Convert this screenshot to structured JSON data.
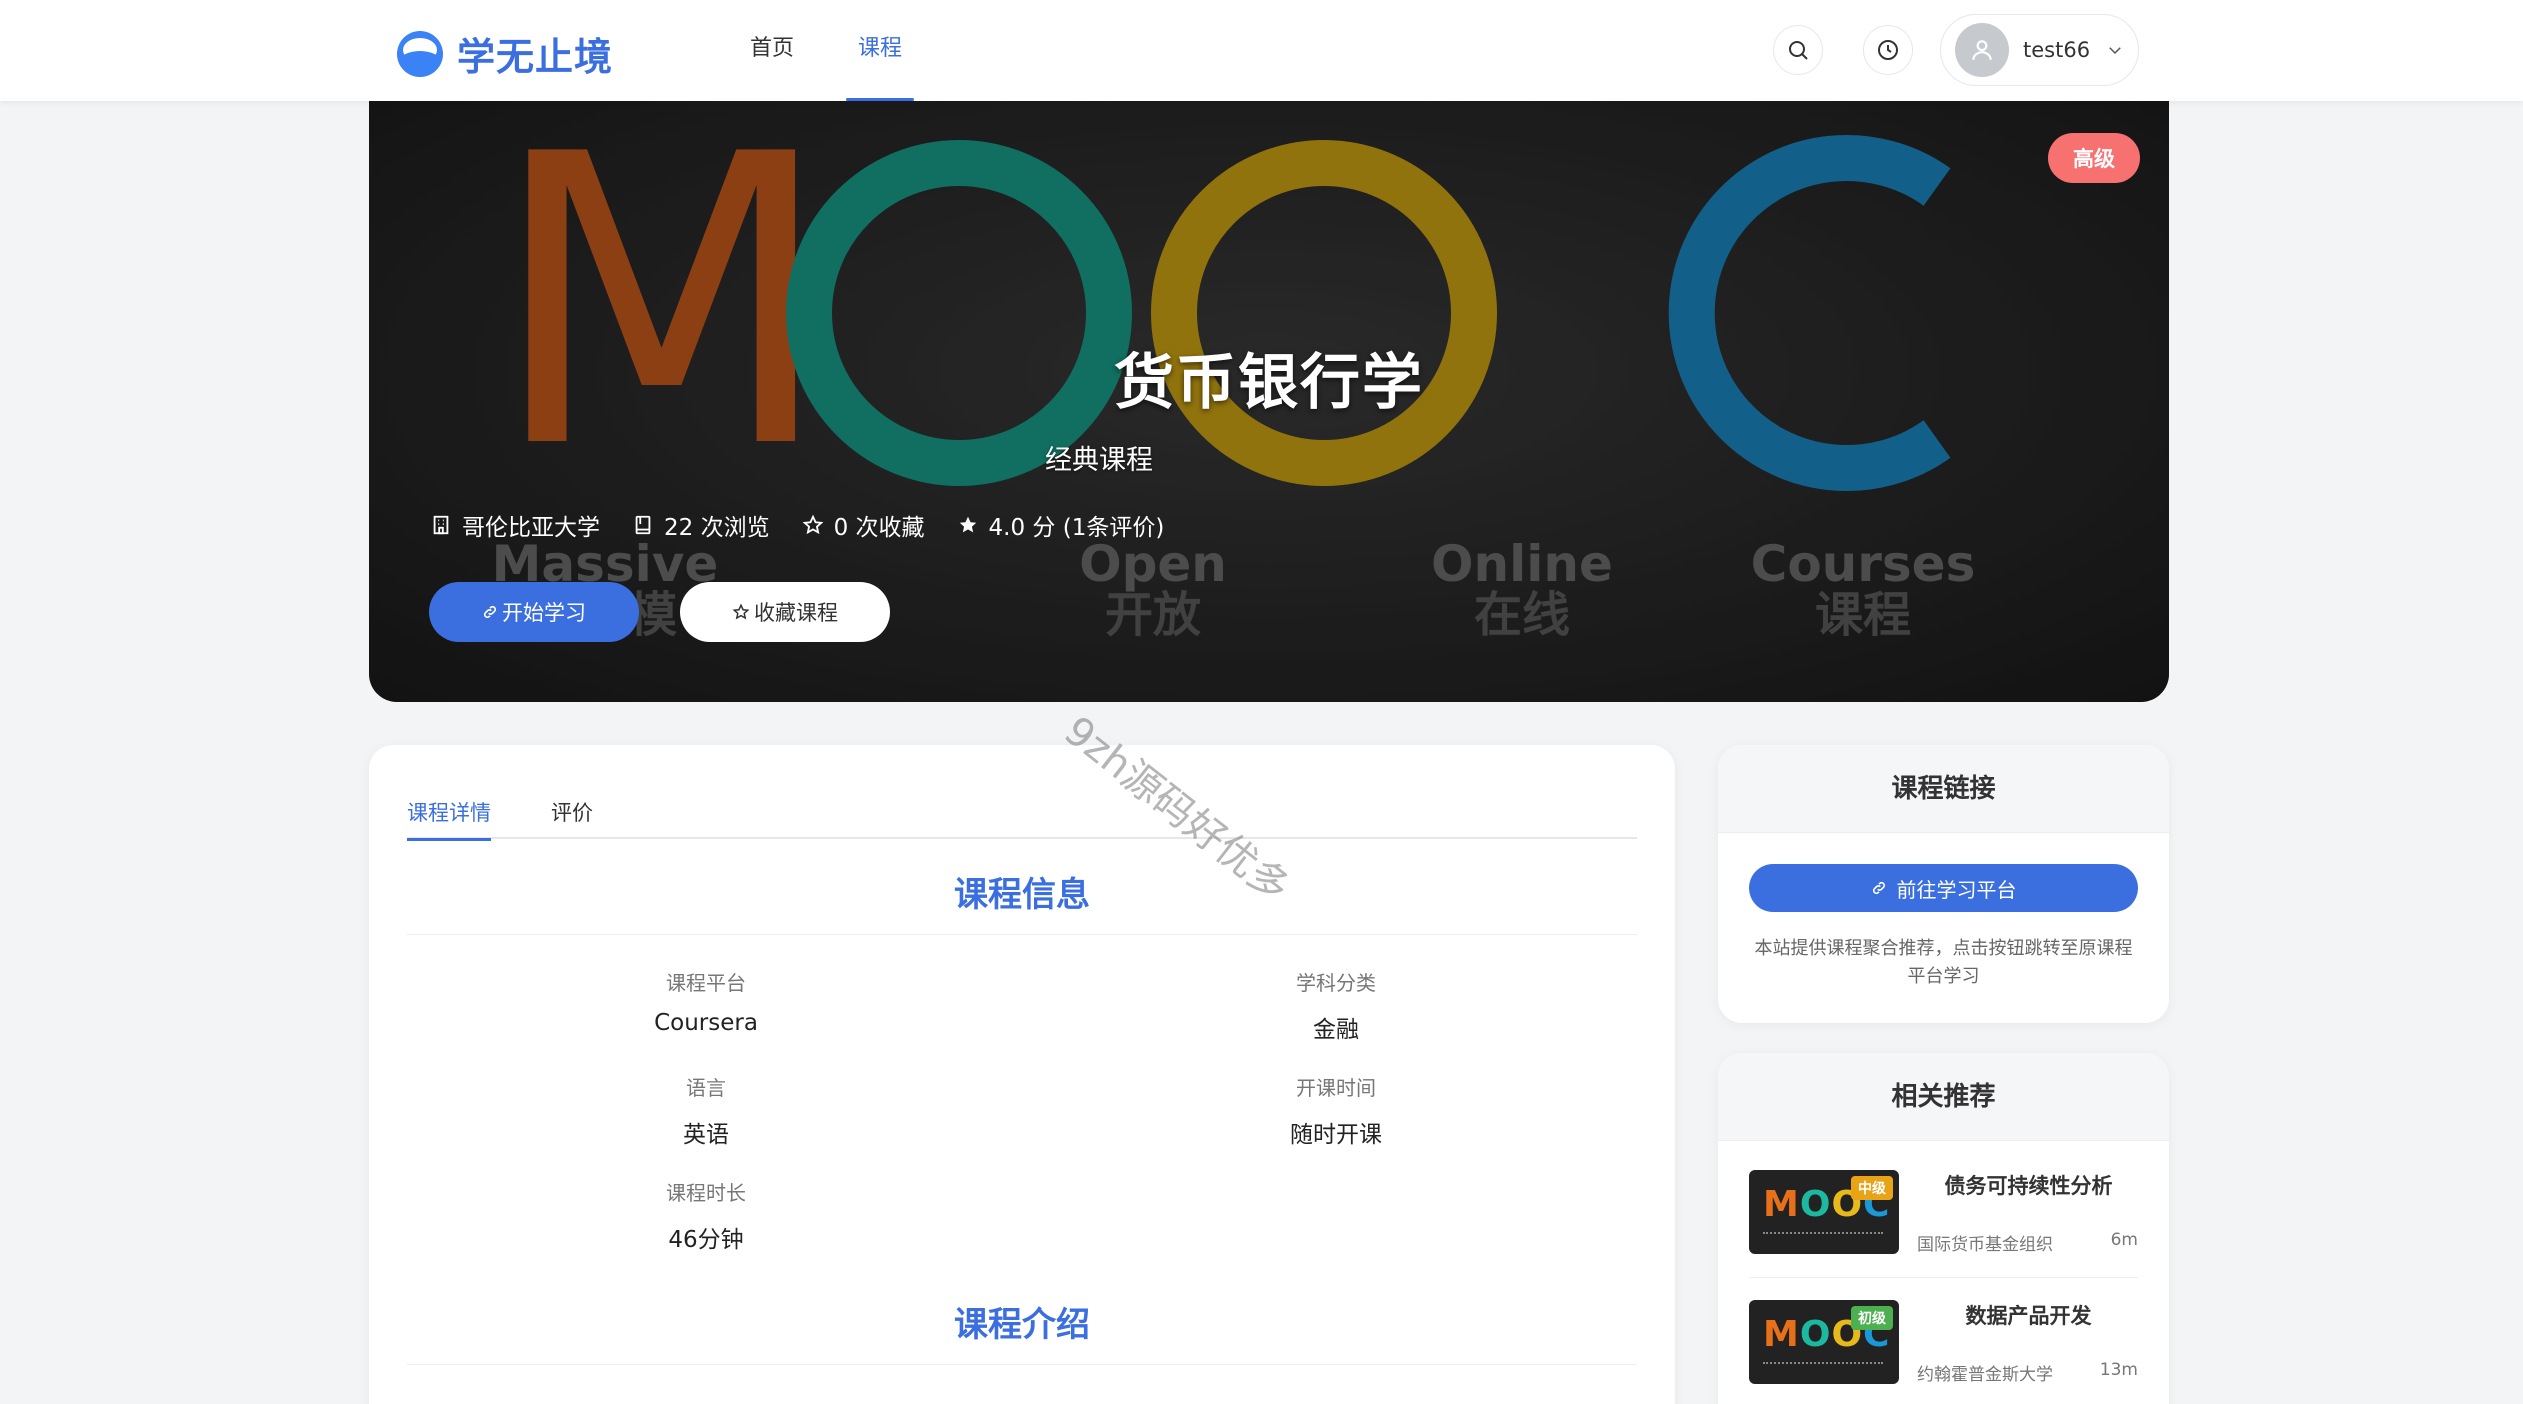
{
  "header": {
    "brand": "学无止境",
    "nav": [
      "首页",
      "课程"
    ],
    "active_nav": "课程",
    "search_icon": "search-icon",
    "history_icon": "clock-icon",
    "username": "test66"
  },
  "hero": {
    "title": "货币银行学",
    "subtitle": "经典课程",
    "level_badge": "高级",
    "university": "哥伦比亚大学",
    "views": "22 次浏览",
    "favorites": "0 次收藏",
    "rating": "4.0 分 (1条评价)",
    "start_button": "开始学习",
    "favorite_button": "收藏课程",
    "background_words": [
      "Massive",
      "Open",
      "Online",
      "Courses"
    ],
    "background_cn": [
      "大规模",
      "开放",
      "在线",
      "课程"
    ]
  },
  "watermark": "9zh源码好优多",
  "tabs": [
    "课程详情",
    "评价"
  ],
  "active_tab": "课程详情",
  "course_info": {
    "title": "课程信息",
    "platform_label": "课程平台",
    "platform": "Coursera",
    "subject_label": "学科分类",
    "subject": "金融",
    "language_label": "语言",
    "language": "英语",
    "start_label": "开课时间",
    "start": "随时开课",
    "duration_label": "课程时长",
    "duration": "46分钟"
  },
  "course_intro": {
    "title": "课程介绍"
  },
  "course_link": {
    "title": "课程链接",
    "button": "前往学习平台",
    "note": "本站提供课程聚合推荐，点击按钮跳转至原课程平台学习"
  },
  "related": {
    "title": "相关推荐",
    "items": [
      {
        "title": "债务可持续性分析",
        "org": "国际货币基金组织",
        "duration": "6m",
        "level": "中级",
        "level_color": "#e8a317"
      },
      {
        "title": "数据产品开发",
        "org": "约翰霍普金斯大学",
        "duration": "13m",
        "level": "初级",
        "level_color": "#4caf50"
      }
    ]
  },
  "colors": {
    "primary": "#3b6fe0",
    "level_advanced": "#f87171"
  }
}
